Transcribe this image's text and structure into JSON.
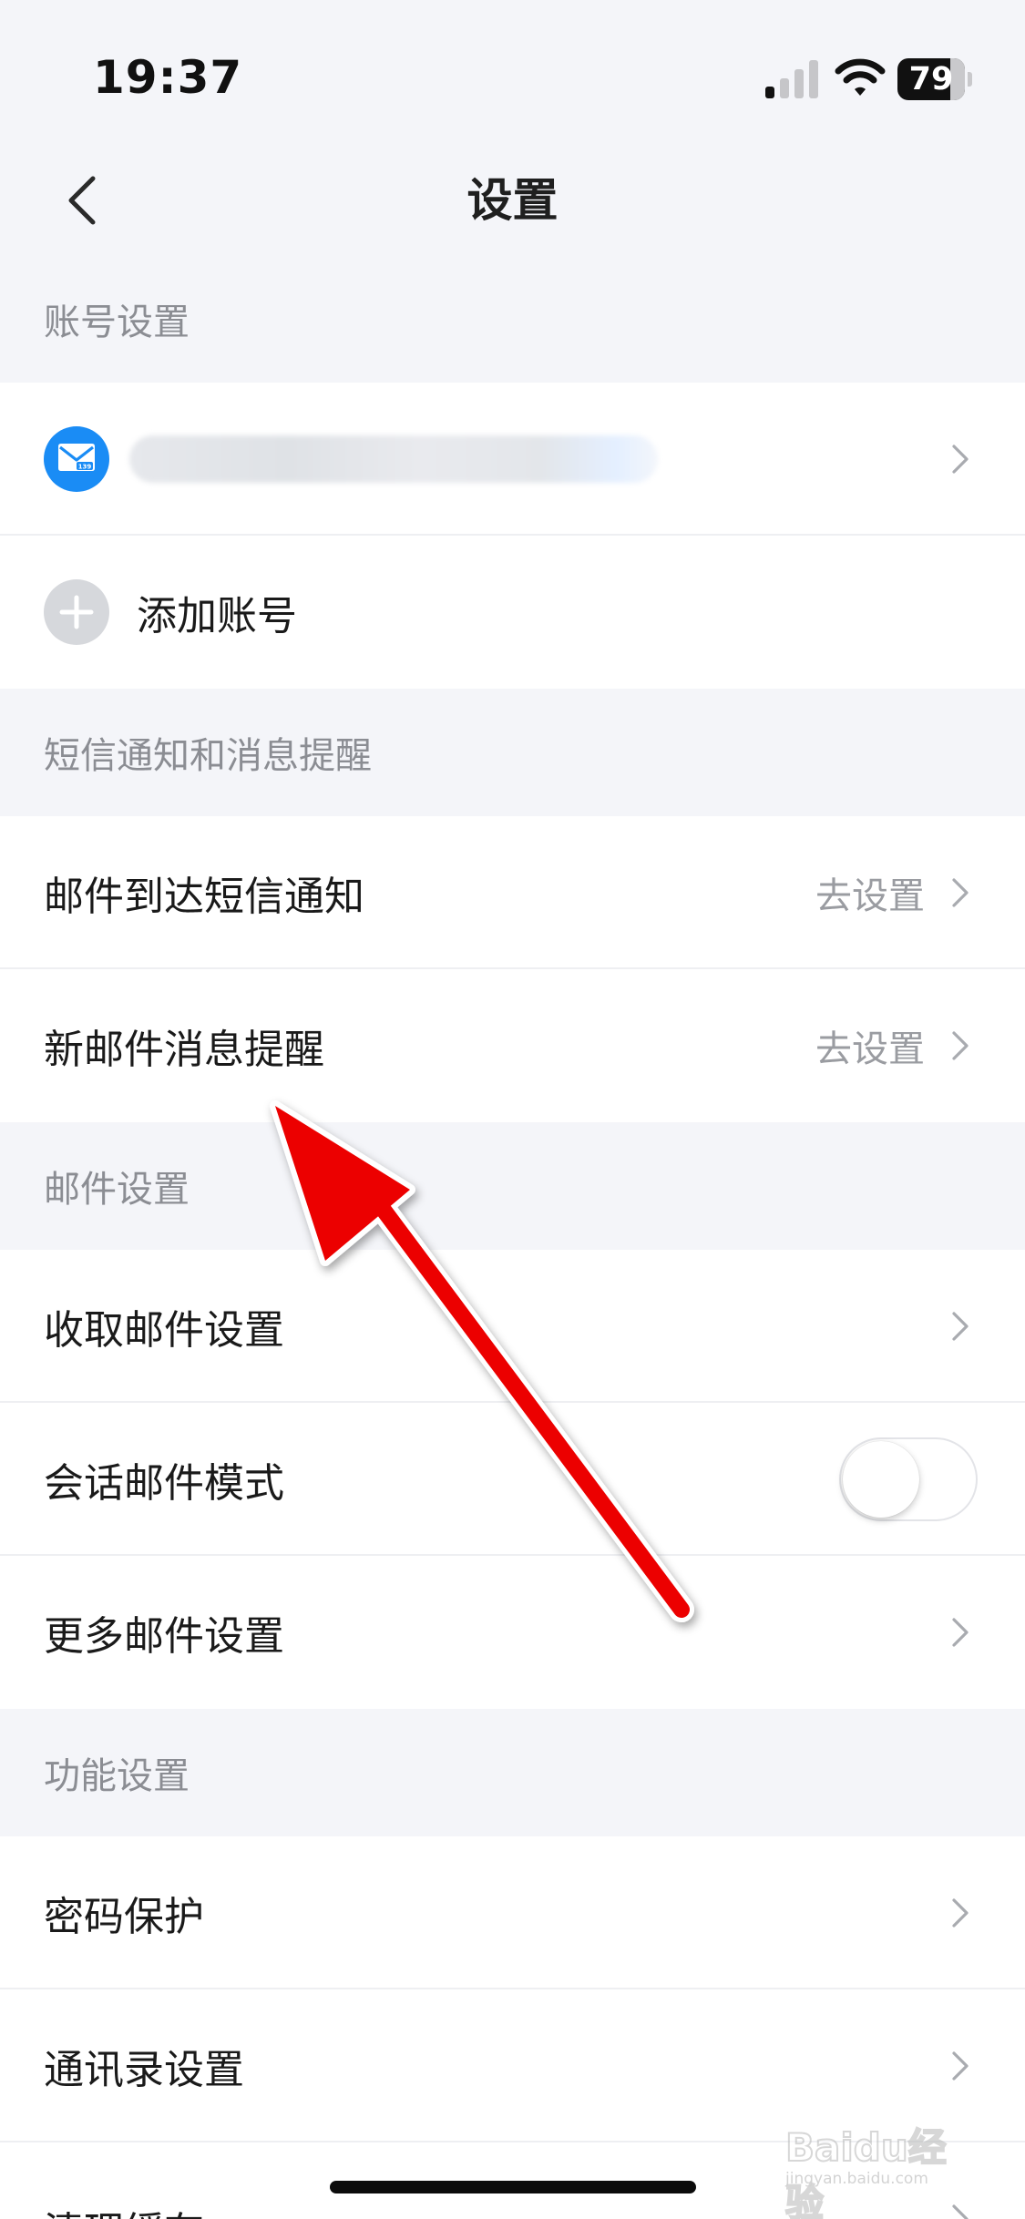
{
  "status_bar": {
    "time": "19:37",
    "battery": "79",
    "battery_level_percent": 79,
    "icons": [
      "signal-icon",
      "wifi-icon",
      "battery-icon"
    ]
  },
  "nav": {
    "title": "设置",
    "back_icon": "chevron-left-icon"
  },
  "sections": {
    "account": {
      "header": "账号设置",
      "account_email": "",
      "add_account_label": "添加账号"
    },
    "sms": {
      "header": "短信通知和消息提醒",
      "items": [
        {
          "label": "邮件到达短信通知",
          "value": "去设置"
        },
        {
          "label": "新邮件消息提醒",
          "value": "去设置"
        }
      ]
    },
    "mail": {
      "header": "邮件设置",
      "items": [
        {
          "label": "收取邮件设置"
        },
        {
          "label": "会话邮件模式",
          "toggle_on": false
        },
        {
          "label": "更多邮件设置"
        }
      ]
    },
    "features": {
      "header": "功能设置",
      "items": [
        {
          "label": "密码保护"
        },
        {
          "label": "通讯录设置"
        },
        {
          "label": "清理缓存"
        }
      ]
    }
  },
  "colors": {
    "background": "#f4f5f9",
    "row_background": "#ffffff",
    "header_text": "#8b8d93",
    "secondary_text": "#9a9ca1",
    "brand_blue": "#1a8cf5",
    "annotation_arrow": "#ff0000"
  },
  "watermark": {
    "brand": "Baidu经验",
    "sub": "jingyan.baidu.com"
  }
}
